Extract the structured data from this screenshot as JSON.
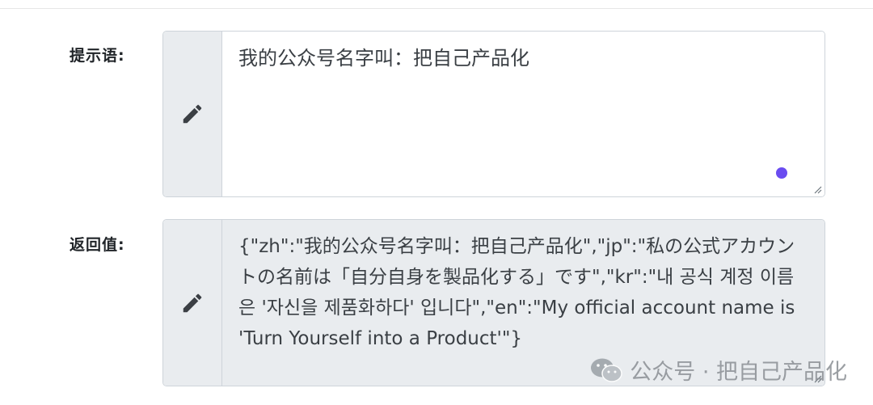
{
  "form": {
    "prompt": {
      "label": "提示语:",
      "value": "我的公众号名字叫：把自己产品化",
      "icon": "pencil-icon"
    },
    "result": {
      "label": "返回值:",
      "value": "{\"zh\":\"我的公众号名字叫：把自己产品化\",\"jp\":\"私の公式アカウントの名前は「自分自身を製品化する」です\",\"kr\":\"내 공식 계정 이름은 '자신을 제품화하다' 입니다\",\"en\":\"My official account name is 'Turn Yourself into a Product'\"}",
      "icon": "pencil-icon"
    }
  },
  "watermark": {
    "text": "公众号 · 把自己产品化",
    "icon": "wechat-icon"
  },
  "colors": {
    "addon_bg": "#e9ecef",
    "border": "#ced4da",
    "cursor_dot": "#6a4cf0"
  }
}
